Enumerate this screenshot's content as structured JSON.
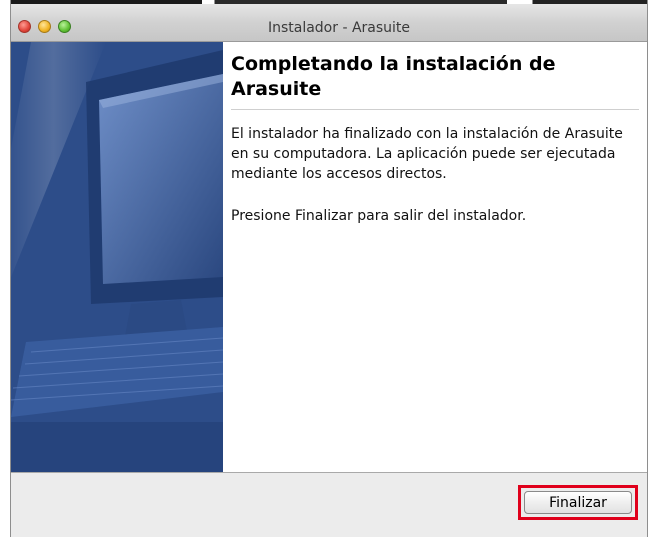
{
  "window": {
    "title": "Instalador - Arasuite"
  },
  "content": {
    "heading": "Completando la instalación de Arasuite",
    "paragraph1": "El instalador ha finalizado con la instalación de Arasuite en su computadora. La aplicación puede ser ejecutada mediante los accesos directos.",
    "paragraph2": "Presione Finalizar para salir del instalador."
  },
  "footer": {
    "finish_label": "Finalizar"
  },
  "colors": {
    "highlight": "#e0001b",
    "banner": "#2e4f8b"
  }
}
